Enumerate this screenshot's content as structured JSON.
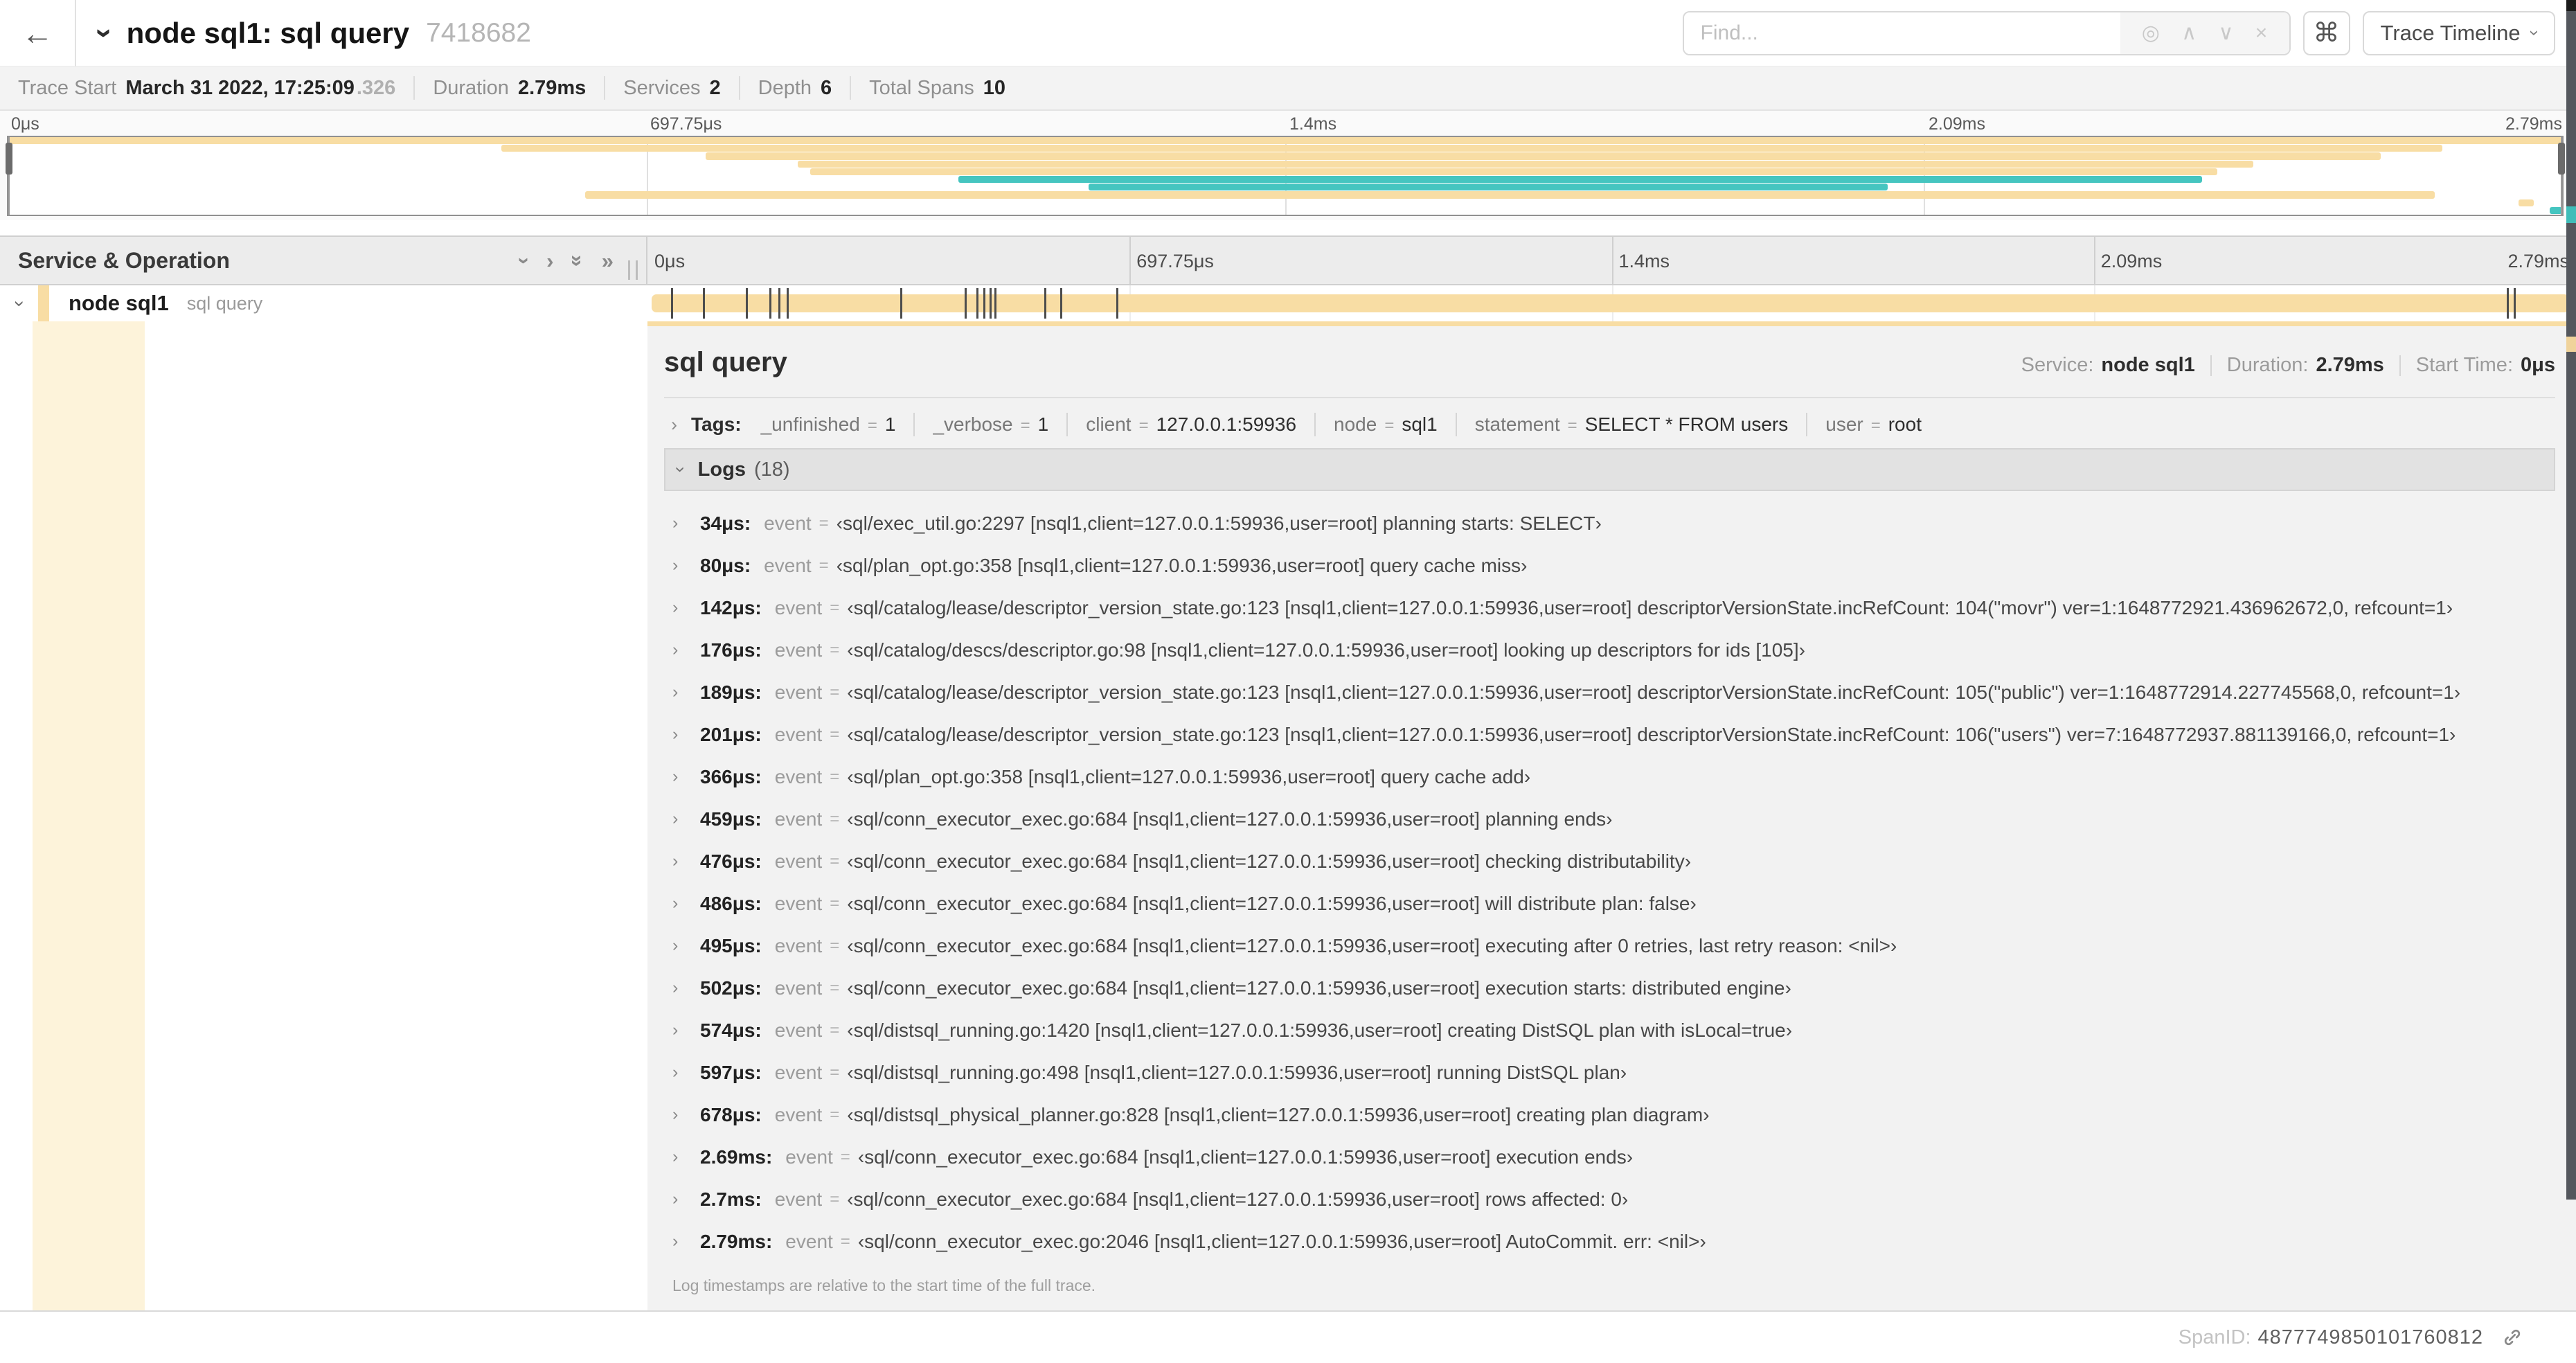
{
  "colors": {
    "tan": "#f8dda4",
    "teal": "#45c5c0",
    "cream": "#fdf3da"
  },
  "icons": {
    "back": "←",
    "chevron": "›",
    "double": "»",
    "command": "⌘",
    "locate": "◎",
    "up": "∧",
    "down": "∨",
    "clear": "×"
  },
  "topbar": {
    "title": "node sql1: sql query",
    "trace_id": "7418682",
    "find_placeholder": "Find...",
    "shortcut_button": "⌘",
    "view_button": "Trace Timeline"
  },
  "stats": [
    {
      "label": "Trace Start",
      "value": "March 31 2022, 17:25:09",
      "suffix": ".326"
    },
    {
      "label": "Duration",
      "value": "2.79ms"
    },
    {
      "label": "Services",
      "value": "2"
    },
    {
      "label": "Depth",
      "value": "6"
    },
    {
      "label": "Total Spans",
      "value": "10"
    }
  ],
  "axis_ticks": [
    "0μs",
    "697.75μs",
    "1.4ms",
    "2.09ms",
    "2.79ms"
  ],
  "axis_positions": [
    0,
    25,
    50,
    75,
    100
  ],
  "minimap": {
    "view_start_pct": 0,
    "view_end_pct": 100,
    "spans": [
      {
        "start": 0,
        "end": 100,
        "color": "tan"
      },
      {
        "start": 19.3,
        "end": 95.3,
        "color": "tan"
      },
      {
        "start": 27.3,
        "end": 92.9,
        "color": "tan"
      },
      {
        "start": 30.9,
        "end": 87.9,
        "color": "tan"
      },
      {
        "start": 31.4,
        "end": 86.5,
        "color": "tan"
      },
      {
        "start": 37.2,
        "end": 85.9,
        "color": "teal"
      },
      {
        "start": 42.3,
        "end": 73.6,
        "color": "teal"
      },
      {
        "start": 22.6,
        "end": 95.0,
        "color": "tan"
      },
      {
        "start": 98.3,
        "end": 98.9,
        "color": "tan"
      },
      {
        "start": 99.5,
        "end": 100,
        "color": "teal"
      }
    ]
  },
  "timeline": {
    "left_header": "Service & Operation"
  },
  "span_row": {
    "service": "node sql1",
    "operation": "sql query"
  },
  "detail": {
    "title": "sql query",
    "meta": [
      {
        "label": "Service:",
        "value": "node sql1"
      },
      {
        "label": "Duration:",
        "value": "2.79ms"
      },
      {
        "label": "Start Time:",
        "value": "0μs"
      }
    ],
    "tags_label": "Tags:",
    "tags": [
      {
        "key": "_unfinished",
        "value": "1"
      },
      {
        "key": "_verbose",
        "value": "1"
      },
      {
        "key": "client",
        "value": "127.0.0.1:59936"
      },
      {
        "key": "node",
        "value": "sql1"
      },
      {
        "key": "statement",
        "value": "SELECT * FROM users"
      },
      {
        "key": "user",
        "value": "root"
      }
    ],
    "logs_label": "Logs",
    "logs_count": "(18)",
    "duration_us": 2790,
    "logs": [
      {
        "time": "34μs:",
        "time_us": 34,
        "field": "event",
        "value": "‹sql/exec_util.go:2297 [nsql1,client=127.0.0.1:59936,user=root] planning starts: SELECT›"
      },
      {
        "time": "80μs:",
        "time_us": 80,
        "field": "event",
        "value": "‹sql/plan_opt.go:358 [nsql1,client=127.0.0.1:59936,user=root] query cache miss›"
      },
      {
        "time": "142μs:",
        "time_us": 142,
        "field": "event",
        "value": "‹sql/catalog/lease/descriptor_version_state.go:123 [nsql1,client=127.0.0.1:59936,user=root] descriptorVersionState.incRefCount: 104(\"movr\") ver=1:1648772921.436962672,0, refcount=1›"
      },
      {
        "time": "176μs:",
        "time_us": 176,
        "field": "event",
        "value": "‹sql/catalog/descs/descriptor.go:98 [nsql1,client=127.0.0.1:59936,user=root] looking up descriptors for ids [105]›"
      },
      {
        "time": "189μs:",
        "time_us": 189,
        "field": "event",
        "value": "‹sql/catalog/lease/descriptor_version_state.go:123 [nsql1,client=127.0.0.1:59936,user=root] descriptorVersionState.incRefCount: 105(\"public\") ver=1:1648772914.227745568,0, refcount=1›"
      },
      {
        "time": "201μs:",
        "time_us": 201,
        "field": "event",
        "value": "‹sql/catalog/lease/descriptor_version_state.go:123 [nsql1,client=127.0.0.1:59936,user=root] descriptorVersionState.incRefCount: 106(\"users\") ver=7:1648772937.881139166,0, refcount=1›"
      },
      {
        "time": "366μs:",
        "time_us": 366,
        "field": "event",
        "value": "‹sql/plan_opt.go:358 [nsql1,client=127.0.0.1:59936,user=root] query cache add›"
      },
      {
        "time": "459μs:",
        "time_us": 459,
        "field": "event",
        "value": "‹sql/conn_executor_exec.go:684 [nsql1,client=127.0.0.1:59936,user=root] planning ends›"
      },
      {
        "time": "476μs:",
        "time_us": 476,
        "field": "event",
        "value": "‹sql/conn_executor_exec.go:684 [nsql1,client=127.0.0.1:59936,user=root] checking distributability›"
      },
      {
        "time": "486μs:",
        "time_us": 486,
        "field": "event",
        "value": "‹sql/conn_executor_exec.go:684 [nsql1,client=127.0.0.1:59936,user=root] will distribute plan: false›"
      },
      {
        "time": "495μs:",
        "time_us": 495,
        "field": "event",
        "value": "‹sql/conn_executor_exec.go:684 [nsql1,client=127.0.0.1:59936,user=root] executing after 0 retries, last retry reason: <nil>›"
      },
      {
        "time": "502μs:",
        "time_us": 502,
        "field": "event",
        "value": "‹sql/conn_executor_exec.go:684 [nsql1,client=127.0.0.1:59936,user=root] execution starts: distributed engine›"
      },
      {
        "time": "574μs:",
        "time_us": 574,
        "field": "event",
        "value": "‹sql/distsql_running.go:1420 [nsql1,client=127.0.0.1:59936,user=root] creating DistSQL plan with isLocal=true›"
      },
      {
        "time": "597μs:",
        "time_us": 597,
        "field": "event",
        "value": "‹sql/distsql_running.go:498 [nsql1,client=127.0.0.1:59936,user=root] running DistSQL plan›"
      },
      {
        "time": "678μs:",
        "time_us": 678,
        "field": "event",
        "value": "‹sql/distsql_physical_planner.go:828 [nsql1,client=127.0.0.1:59936,user=root] creating plan diagram›"
      },
      {
        "time": "2.69ms:",
        "time_us": 2690,
        "field": "event",
        "value": "‹sql/conn_executor_exec.go:684 [nsql1,client=127.0.0.1:59936,user=root] execution ends›"
      },
      {
        "time": "2.7ms:",
        "time_us": 2700,
        "field": "event",
        "value": "‹sql/conn_executor_exec.go:684 [nsql1,client=127.0.0.1:59936,user=root] rows affected: 0›"
      },
      {
        "time": "2.79ms:",
        "time_us": 2790,
        "field": "event",
        "value": "‹sql/conn_executor_exec.go:2046 [nsql1,client=127.0.0.1:59936,user=root] AutoCommit. err: <nil>›"
      }
    ],
    "footer_note": "Log timestamps are relative to the start time of the full trace."
  },
  "footer": {
    "spanid_label": "SpanID:",
    "spanid": "4877749850101760812"
  }
}
